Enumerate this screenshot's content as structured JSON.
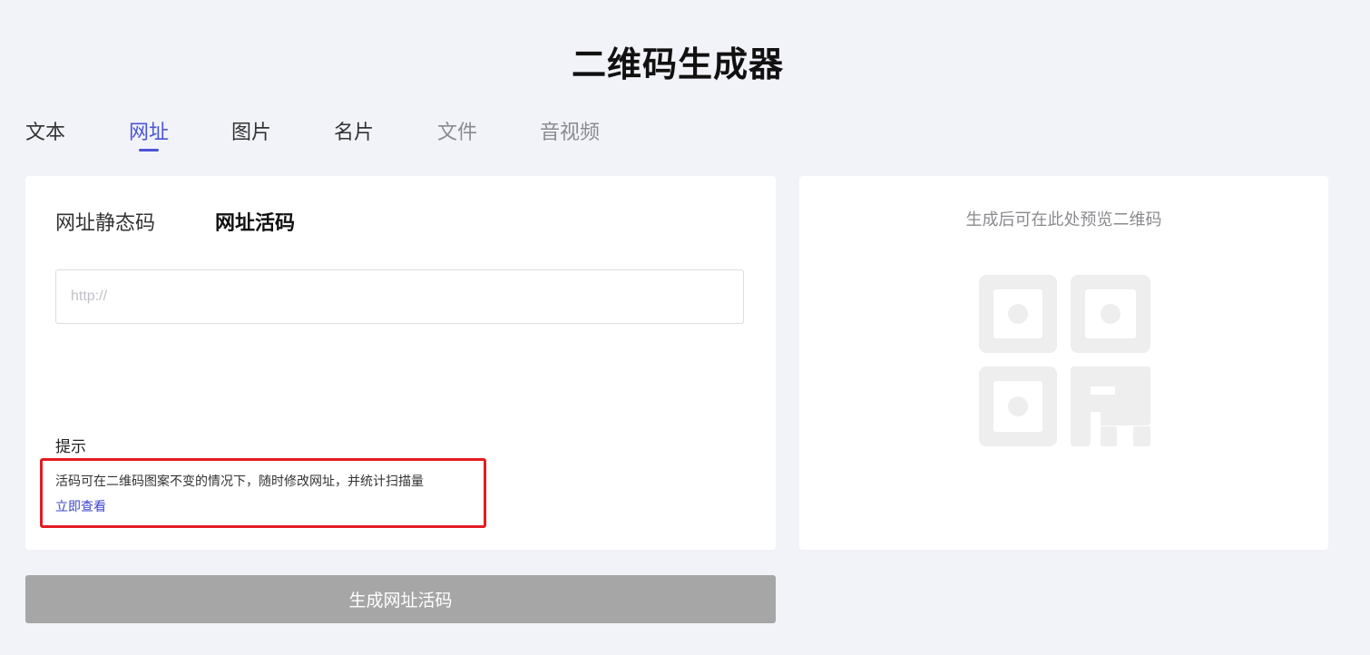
{
  "header": {
    "title": "二维码生成器"
  },
  "tabs": [
    {
      "label": "文本"
    },
    {
      "label": "网址"
    },
    {
      "label": "图片"
    },
    {
      "label": "名片"
    },
    {
      "label": "文件"
    },
    {
      "label": "音视频"
    }
  ],
  "active_tab": "网址",
  "subtabs": {
    "static_label": "网址静态码",
    "live_label": "网址活码"
  },
  "url_input": {
    "placeholder": "http://",
    "value": ""
  },
  "hint": {
    "title": "提示",
    "text": "活码可在二维码图案不变的情况下，随时修改网址，并统计扫描量",
    "link": "立即查看"
  },
  "preview": {
    "text": "生成后可在此处预览二维码",
    "icon": "qr-code-placeholder-icon"
  },
  "generate_button": {
    "label": "生成网址活码"
  },
  "colors": {
    "accent": "#4a55d6",
    "highlight_border": "#e31b23",
    "button_disabled": "#a6a6a6",
    "background": "#f2f3f8"
  }
}
